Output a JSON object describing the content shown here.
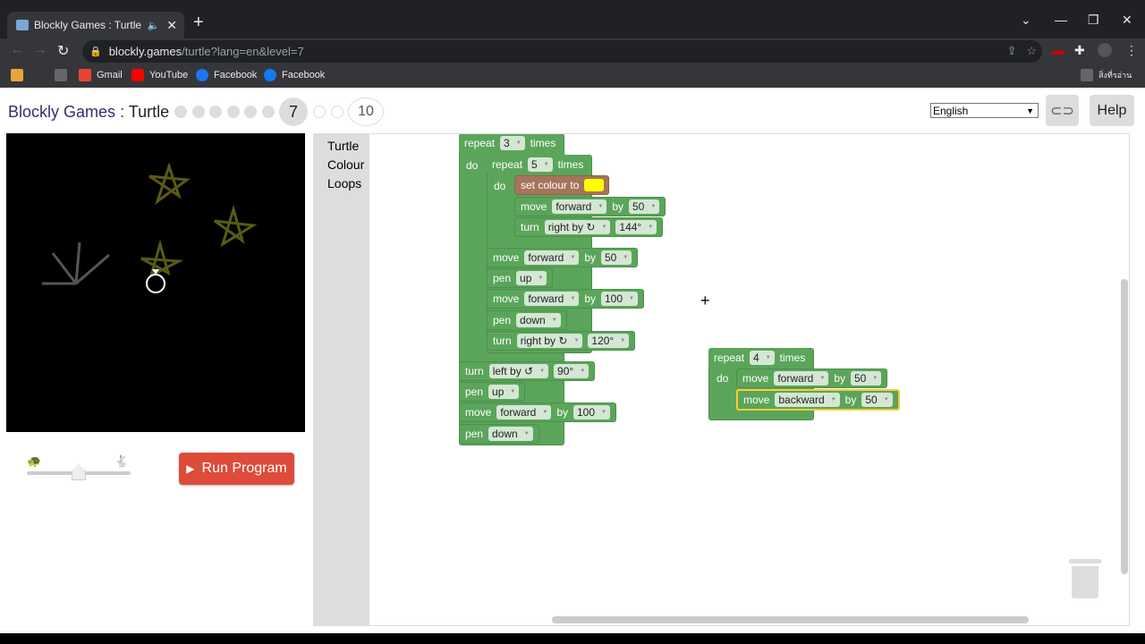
{
  "browser": {
    "tab_title": "Blockly Games : Turtle",
    "url_host": "blockly.games",
    "url_path": "/turtle?lang=en&level=7",
    "bookmarks": [
      "Gmail",
      "YouTube",
      "Facebook",
      "Facebook"
    ],
    "bookmarks_right": "สิ่งที่รอ่าน"
  },
  "header": {
    "app_name": "Blockly Games",
    "separator": ":",
    "game_name": "Turtle",
    "current_level": "7",
    "last_level": "10",
    "language": "English",
    "help_label": "Help"
  },
  "controls": {
    "run_label": "Run Program",
    "speed_level": 0.5
  },
  "toolbox": {
    "categories": [
      "Turtle",
      "Colour",
      "Loops"
    ]
  },
  "blocks": {
    "repeat_outer": {
      "kw": "repeat",
      "count": "3",
      "suffix": "times",
      "do": "do"
    },
    "repeat_inner": {
      "kw": "repeat",
      "count": "5",
      "suffix": "times",
      "do": "do"
    },
    "set_colour": {
      "label": "set colour to",
      "colour": "#ffff00"
    },
    "inner_move": {
      "kw": "move",
      "dir": "forward",
      "by": "by",
      "value": "50"
    },
    "inner_turn": {
      "kw": "turn",
      "dir": "right by ↻",
      "value": "144°"
    },
    "move1": {
      "kw": "move",
      "dir": "forward",
      "by": "by",
      "value": "50"
    },
    "pen1": {
      "kw": "pen",
      "state": "up"
    },
    "move2": {
      "kw": "move",
      "dir": "forward",
      "by": "by",
      "value": "100"
    },
    "pen2": {
      "kw": "pen",
      "state": "down"
    },
    "turn1": {
      "kw": "turn",
      "dir": "right by ↻",
      "value": "120°"
    },
    "turn2": {
      "kw": "turn",
      "dir": "left by ↺",
      "value": "90°"
    },
    "pen3": {
      "kw": "pen",
      "state": "up"
    },
    "move3": {
      "kw": "move",
      "dir": "forward",
      "by": "by",
      "value": "100"
    },
    "pen4": {
      "kw": "pen",
      "state": "down"
    },
    "repeat_floating": {
      "kw": "repeat",
      "count": "4",
      "suffix": "times",
      "do": "do"
    },
    "float_move1": {
      "kw": "move",
      "dir": "forward",
      "by": "by",
      "value": "50"
    },
    "float_move2": {
      "kw": "move",
      "dir": "backward",
      "by": "by",
      "value": "50"
    }
  },
  "colors": {
    "block_green": "#5ba55b",
    "block_brown": "#a5745b",
    "run_red": "#dd4b39",
    "star_yellow": "#5a5a14",
    "selection": "#ffcc33"
  }
}
